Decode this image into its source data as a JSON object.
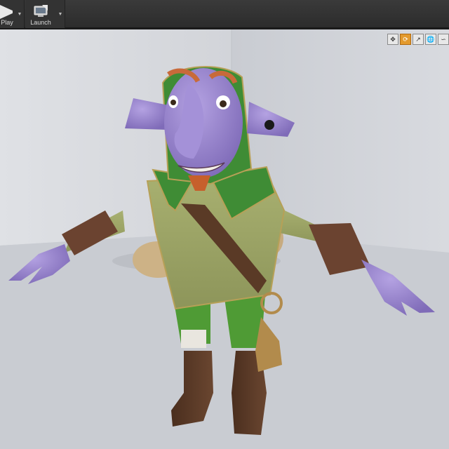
{
  "toolbar": {
    "play": {
      "label": "Play",
      "icon": "play-icon"
    },
    "launch": {
      "label": "Launch",
      "icon": "launch-icon"
    }
  },
  "viewport_tools": [
    {
      "icon": "move-transform-icon",
      "active": false
    },
    {
      "icon": "rotate-transform-icon",
      "active": true
    },
    {
      "icon": "scale-transform-icon",
      "active": false
    },
    {
      "icon": "world-space-icon",
      "active": false
    },
    {
      "icon": "surface-snapping-icon",
      "active": false
    }
  ],
  "colors": {
    "toolbar_bg": "#2f2f2f",
    "viewport_bg": "#cfd2d7",
    "skin": "#9b86cf",
    "tunic": "#9ea767",
    "collar": "#3f8c35",
    "shorts": "#4f9b35",
    "leather": "#5a3a26",
    "brass": "#b28b4c"
  }
}
